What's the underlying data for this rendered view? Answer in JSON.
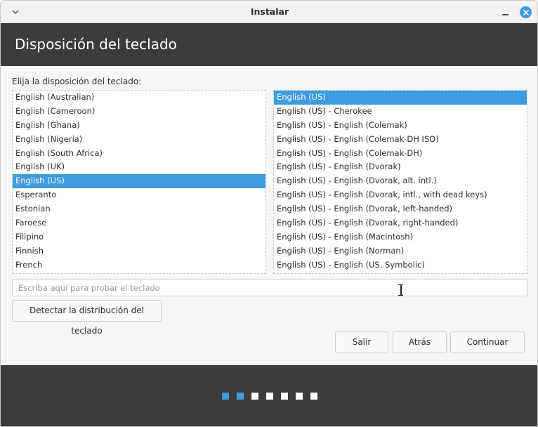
{
  "window": {
    "title": "Instalar"
  },
  "header": {
    "title": "Disposición del teclado"
  },
  "prompt": "Elija la disposición del teclado:",
  "layouts": [
    "English (Australian)",
    "English (Cameroon)",
    "English (Ghana)",
    "English (Nigeria)",
    "English (South Africa)",
    "English (UK)",
    "English (US)",
    "Esperanto",
    "Estonian",
    "Faroese",
    "Filipino",
    "Finnish",
    "French"
  ],
  "layouts_selected": "English (US)",
  "variants": [
    "English (US)",
    "English (US) - Cherokee",
    "English (US) - English (Colemak)",
    "English (US) - English (Colemak-DH ISO)",
    "English (US) - English (Colemak-DH)",
    "English (US) - English (Dvorak)",
    "English (US) - English (Dvorak, alt. intl.)",
    "English (US) - English (Dvorak, intl., with dead keys)",
    "English (US) - English (Dvorak, left-handed)",
    "English (US) - English (Dvorak, right-handed)",
    "English (US) - English (Macintosh)",
    "English (US) - English (Norman)",
    "English (US) - English (US, Symbolic)"
  ],
  "variants_selected": "English (US)",
  "test_input": {
    "value": "",
    "placeholder": "Escriba aquí para probar el teclado"
  },
  "buttons": {
    "detect": "Detectar la distribución del teclado",
    "quit": "Salir",
    "back": "Atrás",
    "continue": "Continuar"
  },
  "progress": {
    "total_steps": 7,
    "completed_steps": 2
  },
  "colors": {
    "accent": "#3d9bde",
    "header_bg": "#3c3c3c"
  }
}
